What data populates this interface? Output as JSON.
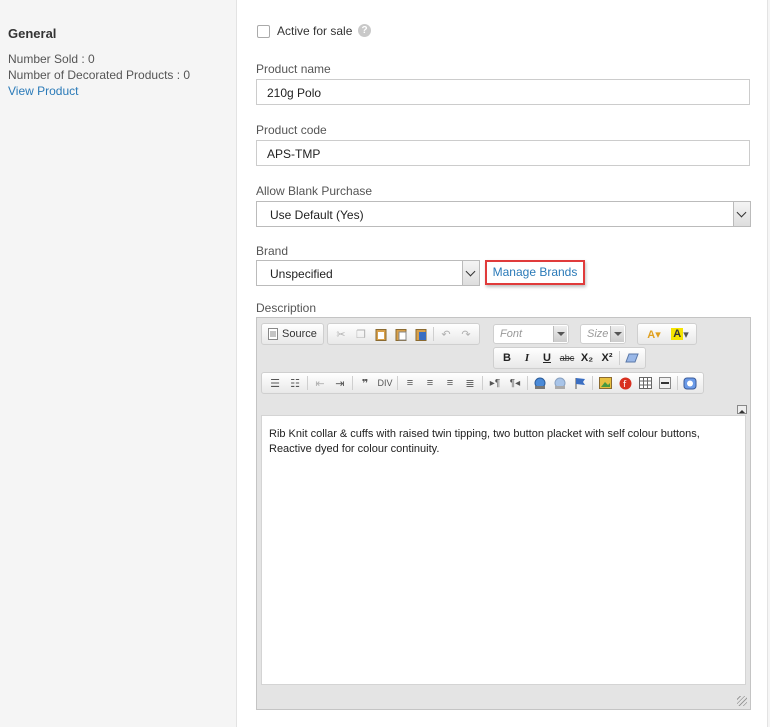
{
  "general": {
    "title": "General",
    "number_sold": "Number Sold : 0",
    "decorated_products": "Number of Decorated Products : 0",
    "view_product_link": "View Product"
  },
  "form": {
    "active_for_sale_label": "Active for sale",
    "active_for_sale_checked": false,
    "help_icon": "?",
    "product_name_label": "Product name",
    "product_name_value": "210g Polo",
    "product_code_label": "Product code",
    "product_code_value": "APS-TMP",
    "allow_blank_label": "Allow Blank Purchase",
    "allow_blank_value": "Use Default (Yes)",
    "brand_label": "Brand",
    "brand_value": "Unspecified",
    "manage_brands_link": "Manage Brands",
    "description_label": "Description"
  },
  "editor": {
    "source_label": "Source",
    "font_placeholder": "Font",
    "size_placeholder": "Size",
    "bold": "B",
    "italic": "I",
    "underline": "U",
    "strike": "abc",
    "subscript": "X₂",
    "superscript": "X²",
    "content": "Rib Knit collar & cuffs with raised twin tipping, two button placket with self colour buttons, Reactive dyed for colour continuity."
  },
  "colors": {
    "link": "#2a7ab8",
    "highlight_border": "#e03b3b"
  }
}
